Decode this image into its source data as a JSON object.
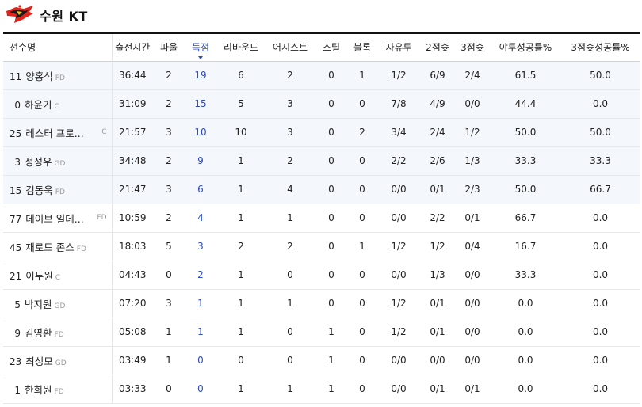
{
  "team": {
    "name": "수원 KT",
    "logo_icon": "sonicboom-logo",
    "logo_colors": {
      "primary": "#e2231a",
      "secondary": "#1a1a1a",
      "accent": "#f5c400"
    }
  },
  "accent_color": "#2c4bbd",
  "columns": [
    {
      "key": "player",
      "label": "선수명"
    },
    {
      "key": "min",
      "label": "출전시간"
    },
    {
      "key": "pf",
      "label": "파울"
    },
    {
      "key": "pts",
      "label": "득점",
      "sorted": true
    },
    {
      "key": "reb",
      "label": "리바운드"
    },
    {
      "key": "ast",
      "label": "어시스트"
    },
    {
      "key": "stl",
      "label": "스틸"
    },
    {
      "key": "blk",
      "label": "블록"
    },
    {
      "key": "ft",
      "label": "자유투"
    },
    {
      "key": "fg2",
      "label": "2점슛"
    },
    {
      "key": "fg3",
      "label": "3점슛"
    },
    {
      "key": "fgpct",
      "label": "야투성공률%"
    },
    {
      "key": "fg3pct",
      "label": "3점슛성공률%"
    }
  ],
  "players": [
    {
      "num": "11",
      "name": "양홍석",
      "pos": "FD",
      "min": "36:44",
      "pf": "2",
      "pts": "19",
      "reb": "6",
      "ast": "2",
      "stl": "0",
      "blk": "1",
      "ft": "1/2",
      "fg2": "6/9",
      "fg3": "2/4",
      "fgpct": "61.5",
      "fg3pct": "50.0",
      "starter": true
    },
    {
      "num": "0",
      "name": "하윤기",
      "pos": "C",
      "min": "31:09",
      "pf": "2",
      "pts": "15",
      "reb": "5",
      "ast": "3",
      "stl": "0",
      "blk": "0",
      "ft": "7/8",
      "fg2": "4/9",
      "fg3": "0/0",
      "fgpct": "44.4",
      "fg3pct": "0.0",
      "starter": true
    },
    {
      "num": "25",
      "name": "레스터 프로...",
      "pos": "C",
      "pos_far": true,
      "min": "21:57",
      "pf": "3",
      "pts": "10",
      "reb": "10",
      "ast": "3",
      "stl": "0",
      "blk": "2",
      "ft": "3/4",
      "fg2": "2/4",
      "fg3": "1/2",
      "fgpct": "50.0",
      "fg3pct": "50.0",
      "starter": true
    },
    {
      "num": "3",
      "name": "정성우",
      "pos": "GD",
      "min": "34:48",
      "pf": "2",
      "pts": "9",
      "reb": "1",
      "ast": "2",
      "stl": "0",
      "blk": "0",
      "ft": "2/2",
      "fg2": "2/6",
      "fg3": "1/3",
      "fgpct": "33.3",
      "fg3pct": "33.3",
      "starter": true
    },
    {
      "num": "15",
      "name": "김동욱",
      "pos": "FD",
      "min": "21:47",
      "pf": "3",
      "pts": "6",
      "reb": "1",
      "ast": "4",
      "stl": "0",
      "blk": "0",
      "ft": "0/0",
      "fg2": "0/1",
      "fg3": "2/3",
      "fgpct": "50.0",
      "fg3pct": "66.7",
      "starter": true
    },
    {
      "num": "77",
      "name": "데이브 일데...",
      "pos": "FD",
      "pos_far": true,
      "min": "10:59",
      "pf": "2",
      "pts": "4",
      "reb": "1",
      "ast": "1",
      "stl": "0",
      "blk": "0",
      "ft": "0/0",
      "fg2": "2/2",
      "fg3": "0/1",
      "fgpct": "66.7",
      "fg3pct": "0.0",
      "starter": false
    },
    {
      "num": "45",
      "name": "재로드 존스",
      "pos": "FD",
      "min": "18:03",
      "pf": "5",
      "pts": "3",
      "reb": "2",
      "ast": "2",
      "stl": "0",
      "blk": "1",
      "ft": "1/2",
      "fg2": "1/2",
      "fg3": "0/4",
      "fgpct": "16.7",
      "fg3pct": "0.0",
      "starter": false
    },
    {
      "num": "21",
      "name": "이두원",
      "pos": "C",
      "min": "04:43",
      "pf": "0",
      "pts": "2",
      "reb": "1",
      "ast": "0",
      "stl": "0",
      "blk": "0",
      "ft": "0/0",
      "fg2": "1/3",
      "fg3": "0/0",
      "fgpct": "33.3",
      "fg3pct": "0.0",
      "starter": false
    },
    {
      "num": "5",
      "name": "박지원",
      "pos": "GD",
      "min": "07:20",
      "pf": "3",
      "pts": "1",
      "reb": "1",
      "ast": "1",
      "stl": "0",
      "blk": "0",
      "ft": "1/2",
      "fg2": "0/1",
      "fg3": "0/0",
      "fgpct": "0.0",
      "fg3pct": "0.0",
      "starter": false
    },
    {
      "num": "9",
      "name": "김영환",
      "pos": "FD",
      "min": "05:08",
      "pf": "1",
      "pts": "1",
      "reb": "1",
      "ast": "0",
      "stl": "1",
      "blk": "0",
      "ft": "1/2",
      "fg2": "0/1",
      "fg3": "0/0",
      "fgpct": "0.0",
      "fg3pct": "0.0",
      "starter": false
    },
    {
      "num": "23",
      "name": "최성모",
      "pos": "GD",
      "min": "03:49",
      "pf": "1",
      "pts": "0",
      "reb": "0",
      "ast": "0",
      "stl": "1",
      "blk": "0",
      "ft": "0/0",
      "fg2": "0/0",
      "fg3": "0/0",
      "fgpct": "0.0",
      "fg3pct": "0.0",
      "starter": false
    },
    {
      "num": "1",
      "name": "한희원",
      "pos": "FD",
      "min": "03:33",
      "pf": "0",
      "pts": "0",
      "reb": "1",
      "ast": "1",
      "stl": "1",
      "blk": "0",
      "ft": "0/0",
      "fg2": "0/1",
      "fg3": "0/1",
      "fgpct": "0.0",
      "fg3pct": "0.0",
      "starter": false
    }
  ]
}
